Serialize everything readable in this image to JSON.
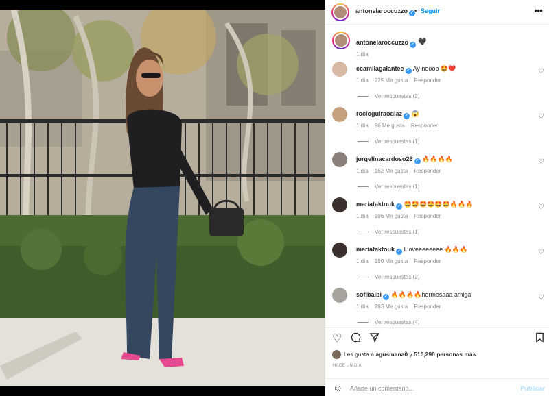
{
  "post": {
    "username": "antonelaroccuzzo",
    "follow_label": "Seguir",
    "separator": "•",
    "more_label": "•••"
  },
  "caption": {
    "username": "antonelaroccuzzo",
    "text": "🖤",
    "time": "1 día"
  },
  "comments": [
    {
      "user": "ccamilagalantee",
      "text": "Ay noooo 🤩❤️",
      "time": "1 día",
      "likes": "225 Me gusta",
      "reply": "Responder",
      "replies": "Ver respuestas (2)"
    },
    {
      "user": "rocioguiraodiaz",
      "text": "😱",
      "time": "1 día",
      "likes": "96 Me gusta",
      "reply": "Responder",
      "replies": "Ver respuestas (1)"
    },
    {
      "user": "jorgelinacardoso26",
      "text": "🔥🔥🔥🔥",
      "time": "1 día",
      "likes": "162 Me gusta",
      "reply": "Responder",
      "replies": "Ver respuestas (1)"
    },
    {
      "user": "mariataktouk",
      "text": "🤩🤩🤩🤩🤩🤩🔥🔥🔥",
      "time": "1 día",
      "likes": "106 Me gusta",
      "reply": "Responder",
      "replies": "Ver respuestas (1)"
    },
    {
      "user": "mariataktouk",
      "text": "I loveeeeeeee 🔥🔥🔥",
      "time": "1 día",
      "likes": "150 Me gusta",
      "reply": "Responder",
      "replies": "Ver respuestas (2)"
    },
    {
      "user": "sofibalbi",
      "text": "🔥🔥🔥🔥hermosaaa amiga",
      "time": "1 día",
      "likes": "283 Me gusta",
      "reply": "Responder",
      "replies": "Ver respuestas (4)"
    }
  ],
  "likes": {
    "prefix": "Les gusta a",
    "user": "agusmana0",
    "middle": "y",
    "count": "510,290 personas más"
  },
  "time_ago": "HACE UN DÍA",
  "add_comment": {
    "placeholder": "Añade un comentario...",
    "post_label": "Publicar"
  },
  "icons": {
    "heart": "heart-icon",
    "comment": "comment-icon",
    "share": "share-icon",
    "save": "bookmark-icon",
    "emoji": "emoji-icon",
    "more": "more-icon"
  },
  "colors": {
    "verified": "#3897f0",
    "link": "#0095f6",
    "muted": "#8e8e8e"
  }
}
